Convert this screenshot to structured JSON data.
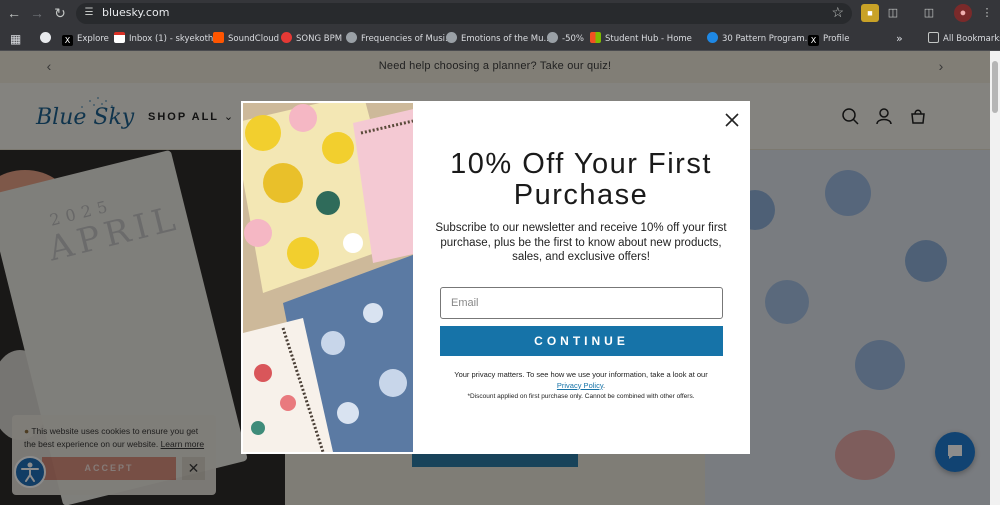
{
  "browser": {
    "url": "bluesky.com",
    "bookmarks": [
      {
        "label": "Explore",
        "icon": "x-icon"
      },
      {
        "label": "Inbox (1) - skyekoth...",
        "icon": "gmail-icon"
      },
      {
        "label": "SoundCloud",
        "icon": "soundcloud-icon"
      },
      {
        "label": "SONG BPM",
        "icon": "songbpm-icon"
      },
      {
        "label": "Frequencies of Musi...",
        "icon": "globe-icon"
      },
      {
        "label": "Emotions of the Mu...",
        "icon": "globe-icon"
      },
      {
        "label": "-50%",
        "icon": "globe-icon"
      },
      {
        "label": "Student Hub - Home",
        "icon": "windows-icon"
      },
      {
        "label": "30 Pattern Program...",
        "icon": "edge-icon"
      },
      {
        "label": "Profile",
        "icon": "x-icon"
      }
    ],
    "all_bookmarks": "All Bookmarks"
  },
  "site": {
    "promo": "Need help choosing a planner? Take our quiz!",
    "logo": "Blue Sky",
    "nav_shop_all": "SHOP ALL",
    "hero_year": "2025",
    "hero_month": "APRIL"
  },
  "modal": {
    "title": "10% Off Your First Purchase",
    "description": "Subscribe to our newsletter and receive 10% off your first purchase, plus be the first to know about new products, sales, and exclusive offers!",
    "email_placeholder": "Email",
    "continue_label": "CONTINUE",
    "privacy_text": "Your privacy matters. To see how we use your information, take a look at our",
    "privacy_link": "Privacy Policy",
    "disclaimer": "*Discount applied on first purchase only. Cannot be combined with other offers."
  },
  "cookie": {
    "text": "This website uses cookies to ensure you get the best experience on our website.",
    "learn_more": "Learn more",
    "accept_label": "ACCEPT",
    "close_label": "✕"
  },
  "colors": {
    "brand_blue": "#1673a8",
    "accept_salmon": "#d98d7c",
    "chat_blue": "#1f7ad0"
  }
}
